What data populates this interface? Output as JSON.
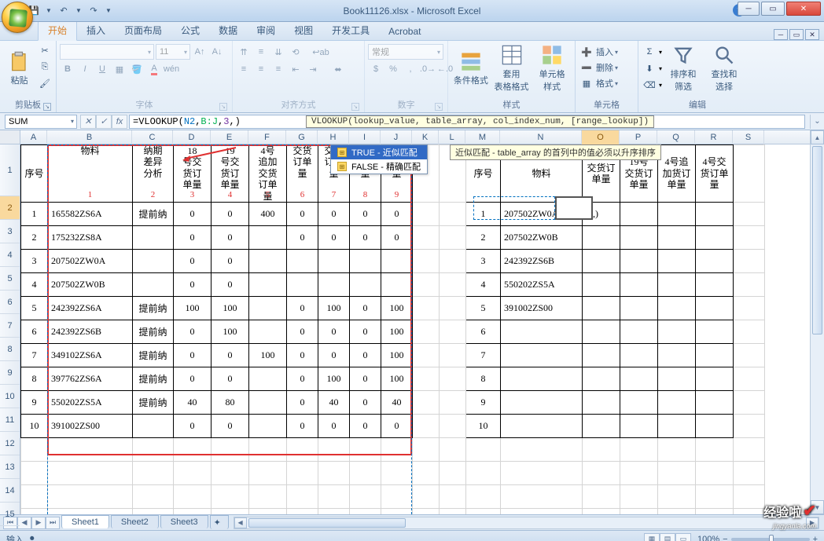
{
  "window": {
    "title": "Book11126.xlsx - Microsoft Excel"
  },
  "qat": {
    "save": "💾",
    "undo": "↶",
    "redo": "↷"
  },
  "tabs": [
    "开始",
    "插入",
    "页面布局",
    "公式",
    "数据",
    "审阅",
    "视图",
    "开发工具",
    "Acrobat"
  ],
  "activeTab": 0,
  "ribbon": {
    "clipboard": {
      "label": "剪贴板",
      "paste": "粘贴"
    },
    "font": {
      "label": "字体",
      "name": "",
      "size": "11",
      "b": "B",
      "i": "I",
      "u": "U"
    },
    "align": {
      "label": "对齐方式"
    },
    "number": {
      "label": "数字",
      "fmt": "常规"
    },
    "styles": {
      "label": "样式",
      "cond": "条件格式",
      "fmt_table": "套用\n表格格式",
      "cell": "单元格\n样式"
    },
    "cells": {
      "label": "单元格",
      "insert": "插入",
      "delete": "删除",
      "format": "格式"
    },
    "edit": {
      "label": "编辑",
      "sort": "排序和\n筛选",
      "find": "查找和\n选择"
    }
  },
  "namebox": "SUM",
  "formula": {
    "pre": "=VLOOKUP(",
    "n2": "N2",
    "c1": ",",
    "bj": "B:J",
    "c2": ",",
    "three": "3",
    "c3": ",",
    "end": ")"
  },
  "fhint": "VLOOKUP(lookup_value, table_array, col_index_num, [range_lookup])",
  "intelli": {
    "true": "TRUE - 近似匹配",
    "false": "FALSE - 精确匹配"
  },
  "tooltip": "近似匹配 - table_array 的首列中的值必须以升序排序",
  "cols": [
    "A",
    "B",
    "C",
    "D",
    "E",
    "F",
    "G",
    "H",
    "I",
    "J",
    "K",
    "L",
    "M",
    "N",
    "O",
    "P",
    "Q",
    "R",
    "S"
  ],
  "headerRow": {
    "A": "序号",
    "B": "物料",
    "C": "纳期差异分析",
    "D": "18号交货订单量",
    "E": "19号交货订单量",
    "F": "4号追加交货订单量",
    "G": "交货订单量",
    "H": "交货订单量",
    "I": "交货订单量",
    "J": "交货订单量",
    "M": "序号",
    "N": "物料",
    "O": "交货订单量",
    "P": "19号交货订单量",
    "Q": "4号追加货订单量",
    "R": "4号交货订单量",
    "S": ""
  },
  "rednums": {
    "B": "1",
    "C": "2",
    "D": "3",
    "E": "4",
    "F": "5",
    "G": "6",
    "H": "7",
    "I": "8",
    "J": "9"
  },
  "leftRows": [
    {
      "n": "1",
      "b": "165582ZS6A",
      "c": "提前纳",
      "d": "0",
      "e": "0",
      "f": "400",
      "g": "0",
      "h": "0",
      "i": "0",
      "j": "0"
    },
    {
      "n": "2",
      "b": "175232ZS8A",
      "c": "",
      "d": "0",
      "e": "0",
      "f": "",
      "g": "0",
      "h": "0",
      "i": "0",
      "j": "0"
    },
    {
      "n": "3",
      "b": "207502ZW0A",
      "c": "",
      "d": "0",
      "e": "0",
      "f": "",
      "g": "",
      "h": "",
      "i": "",
      "j": ""
    },
    {
      "n": "4",
      "b": "207502ZW0B",
      "c": "",
      "d": "0",
      "e": "0",
      "f": "",
      "g": "",
      "h": "",
      "i": "",
      "j": ""
    },
    {
      "n": "5",
      "b": "242392ZS6A",
      "c": "提前纳",
      "d": "100",
      "e": "100",
      "f": "",
      "g": "0",
      "h": "100",
      "i": "0",
      "j": "100"
    },
    {
      "n": "6",
      "b": "242392ZS6B",
      "c": "提前纳",
      "d": "0",
      "e": "100",
      "f": "",
      "g": "0",
      "h": "0",
      "i": "0",
      "j": "100"
    },
    {
      "n": "7",
      "b": "349102ZS6A",
      "c": "提前纳",
      "d": "0",
      "e": "0",
      "f": "100",
      "g": "0",
      "h": "0",
      "i": "0",
      "j": "100"
    },
    {
      "n": "8",
      "b": "397762ZS6A",
      "c": "提前纳",
      "d": "0",
      "e": "0",
      "f": "",
      "g": "0",
      "h": "100",
      "i": "0",
      "j": "100"
    },
    {
      "n": "9",
      "b": "550202ZS5A",
      "c": "提前纳",
      "d": "40",
      "e": "80",
      "f": "",
      "g": "0",
      "h": "40",
      "i": "0",
      "j": "40"
    },
    {
      "n": "10",
      "b": "391002ZS00",
      "c": "",
      "d": "0",
      "e": "0",
      "f": "",
      "g": "0",
      "h": "0",
      "i": "0",
      "j": "0"
    }
  ],
  "rightRows": [
    {
      "m": "1",
      "n": "207502ZW0A",
      "o": ",3,)"
    },
    {
      "m": "2",
      "n": "207502ZW0B",
      "o": ""
    },
    {
      "m": "3",
      "n": "242392ZS6B",
      "o": ""
    },
    {
      "m": "4",
      "n": "550202ZS5A",
      "o": ""
    },
    {
      "m": "5",
      "n": "391002ZS00",
      "o": ""
    },
    {
      "m": "6",
      "n": "",
      "o": ""
    },
    {
      "m": "7",
      "n": "",
      "o": ""
    },
    {
      "m": "8",
      "n": "",
      "o": ""
    },
    {
      "m": "9",
      "n": "",
      "o": ""
    },
    {
      "m": "10",
      "n": "",
      "o": ""
    }
  ],
  "sheetTabs": [
    "Sheet1",
    "Sheet2",
    "Sheet3"
  ],
  "status": {
    "mode": "输入",
    "zoom": "100%"
  },
  "watermark": {
    "text": "经验啦",
    "url": "jingyanla.com"
  }
}
